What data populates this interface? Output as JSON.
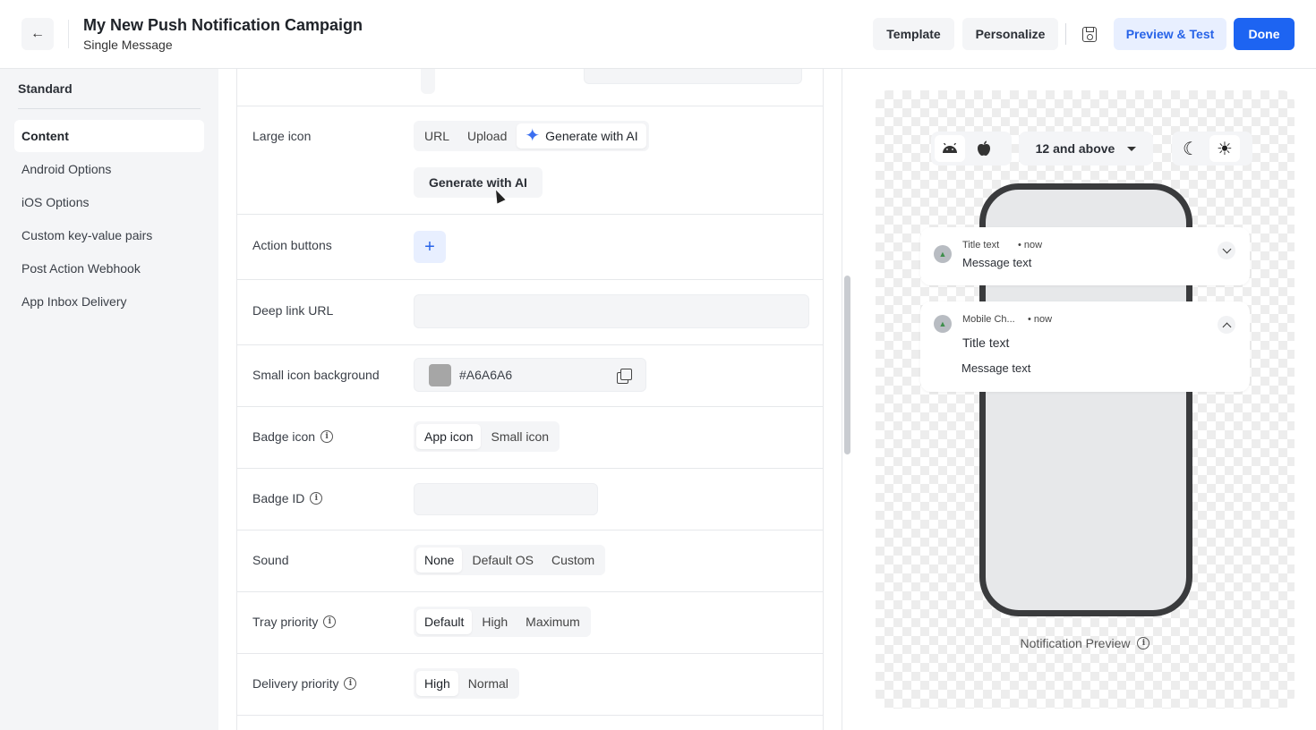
{
  "header": {
    "title": "My New Push Notification Campaign",
    "subtitle": "Single Message",
    "back_icon": "arrow-left-icon",
    "buttons": {
      "template": "Template",
      "personalize": "Personalize",
      "save_icon": "save-icon",
      "preview_test": "Preview & Test",
      "done": "Done"
    }
  },
  "sidebar": {
    "heading": "Standard",
    "items": [
      {
        "label": "Content",
        "active": true
      },
      {
        "label": "Android Options"
      },
      {
        "label": "iOS Options"
      },
      {
        "label": "Custom key-value pairs"
      },
      {
        "label": "Post Action Webhook"
      },
      {
        "label": "App Inbox Delivery"
      }
    ]
  },
  "form": {
    "large_icon": {
      "label": "Large icon",
      "options": [
        "URL",
        "Upload",
        "Generate with AI"
      ],
      "selected": "Generate with AI",
      "button": "Generate with AI"
    },
    "action_buttons": {
      "label": "Action buttons",
      "add": "+"
    },
    "deep_link": {
      "label": "Deep link URL",
      "value": ""
    },
    "small_icon_bg": {
      "label": "Small icon background",
      "value": "#A6A6A6",
      "swatch_color": "#A6A6A6"
    },
    "badge_icon": {
      "label": "Badge icon",
      "options": [
        "App icon",
        "Small icon"
      ],
      "selected": "App icon"
    },
    "badge_id": {
      "label": "Badge ID",
      "value": ""
    },
    "sound": {
      "label": "Sound",
      "options": [
        "None",
        "Default OS",
        "Custom"
      ],
      "selected": "None"
    },
    "tray_priority": {
      "label": "Tray priority",
      "options": [
        "Default",
        "High",
        "Maximum"
      ],
      "selected": "Default"
    },
    "delivery_priority": {
      "label": "Delivery priority",
      "options": [
        "High",
        "Normal"
      ],
      "selected": "High"
    }
  },
  "preview": {
    "os_selected": "android",
    "version": "12 and above",
    "theme_selected": "light",
    "collapsed": {
      "title": "Title text",
      "time": "• now",
      "message": "Message text"
    },
    "expanded": {
      "app": "Mobile Ch...",
      "time": "• now",
      "title": "Title text",
      "message": "Message text"
    },
    "caption": "Notification Preview"
  },
  "colors": {
    "accent": "#1D64F2",
    "accent_light": "#E8EFFF"
  }
}
